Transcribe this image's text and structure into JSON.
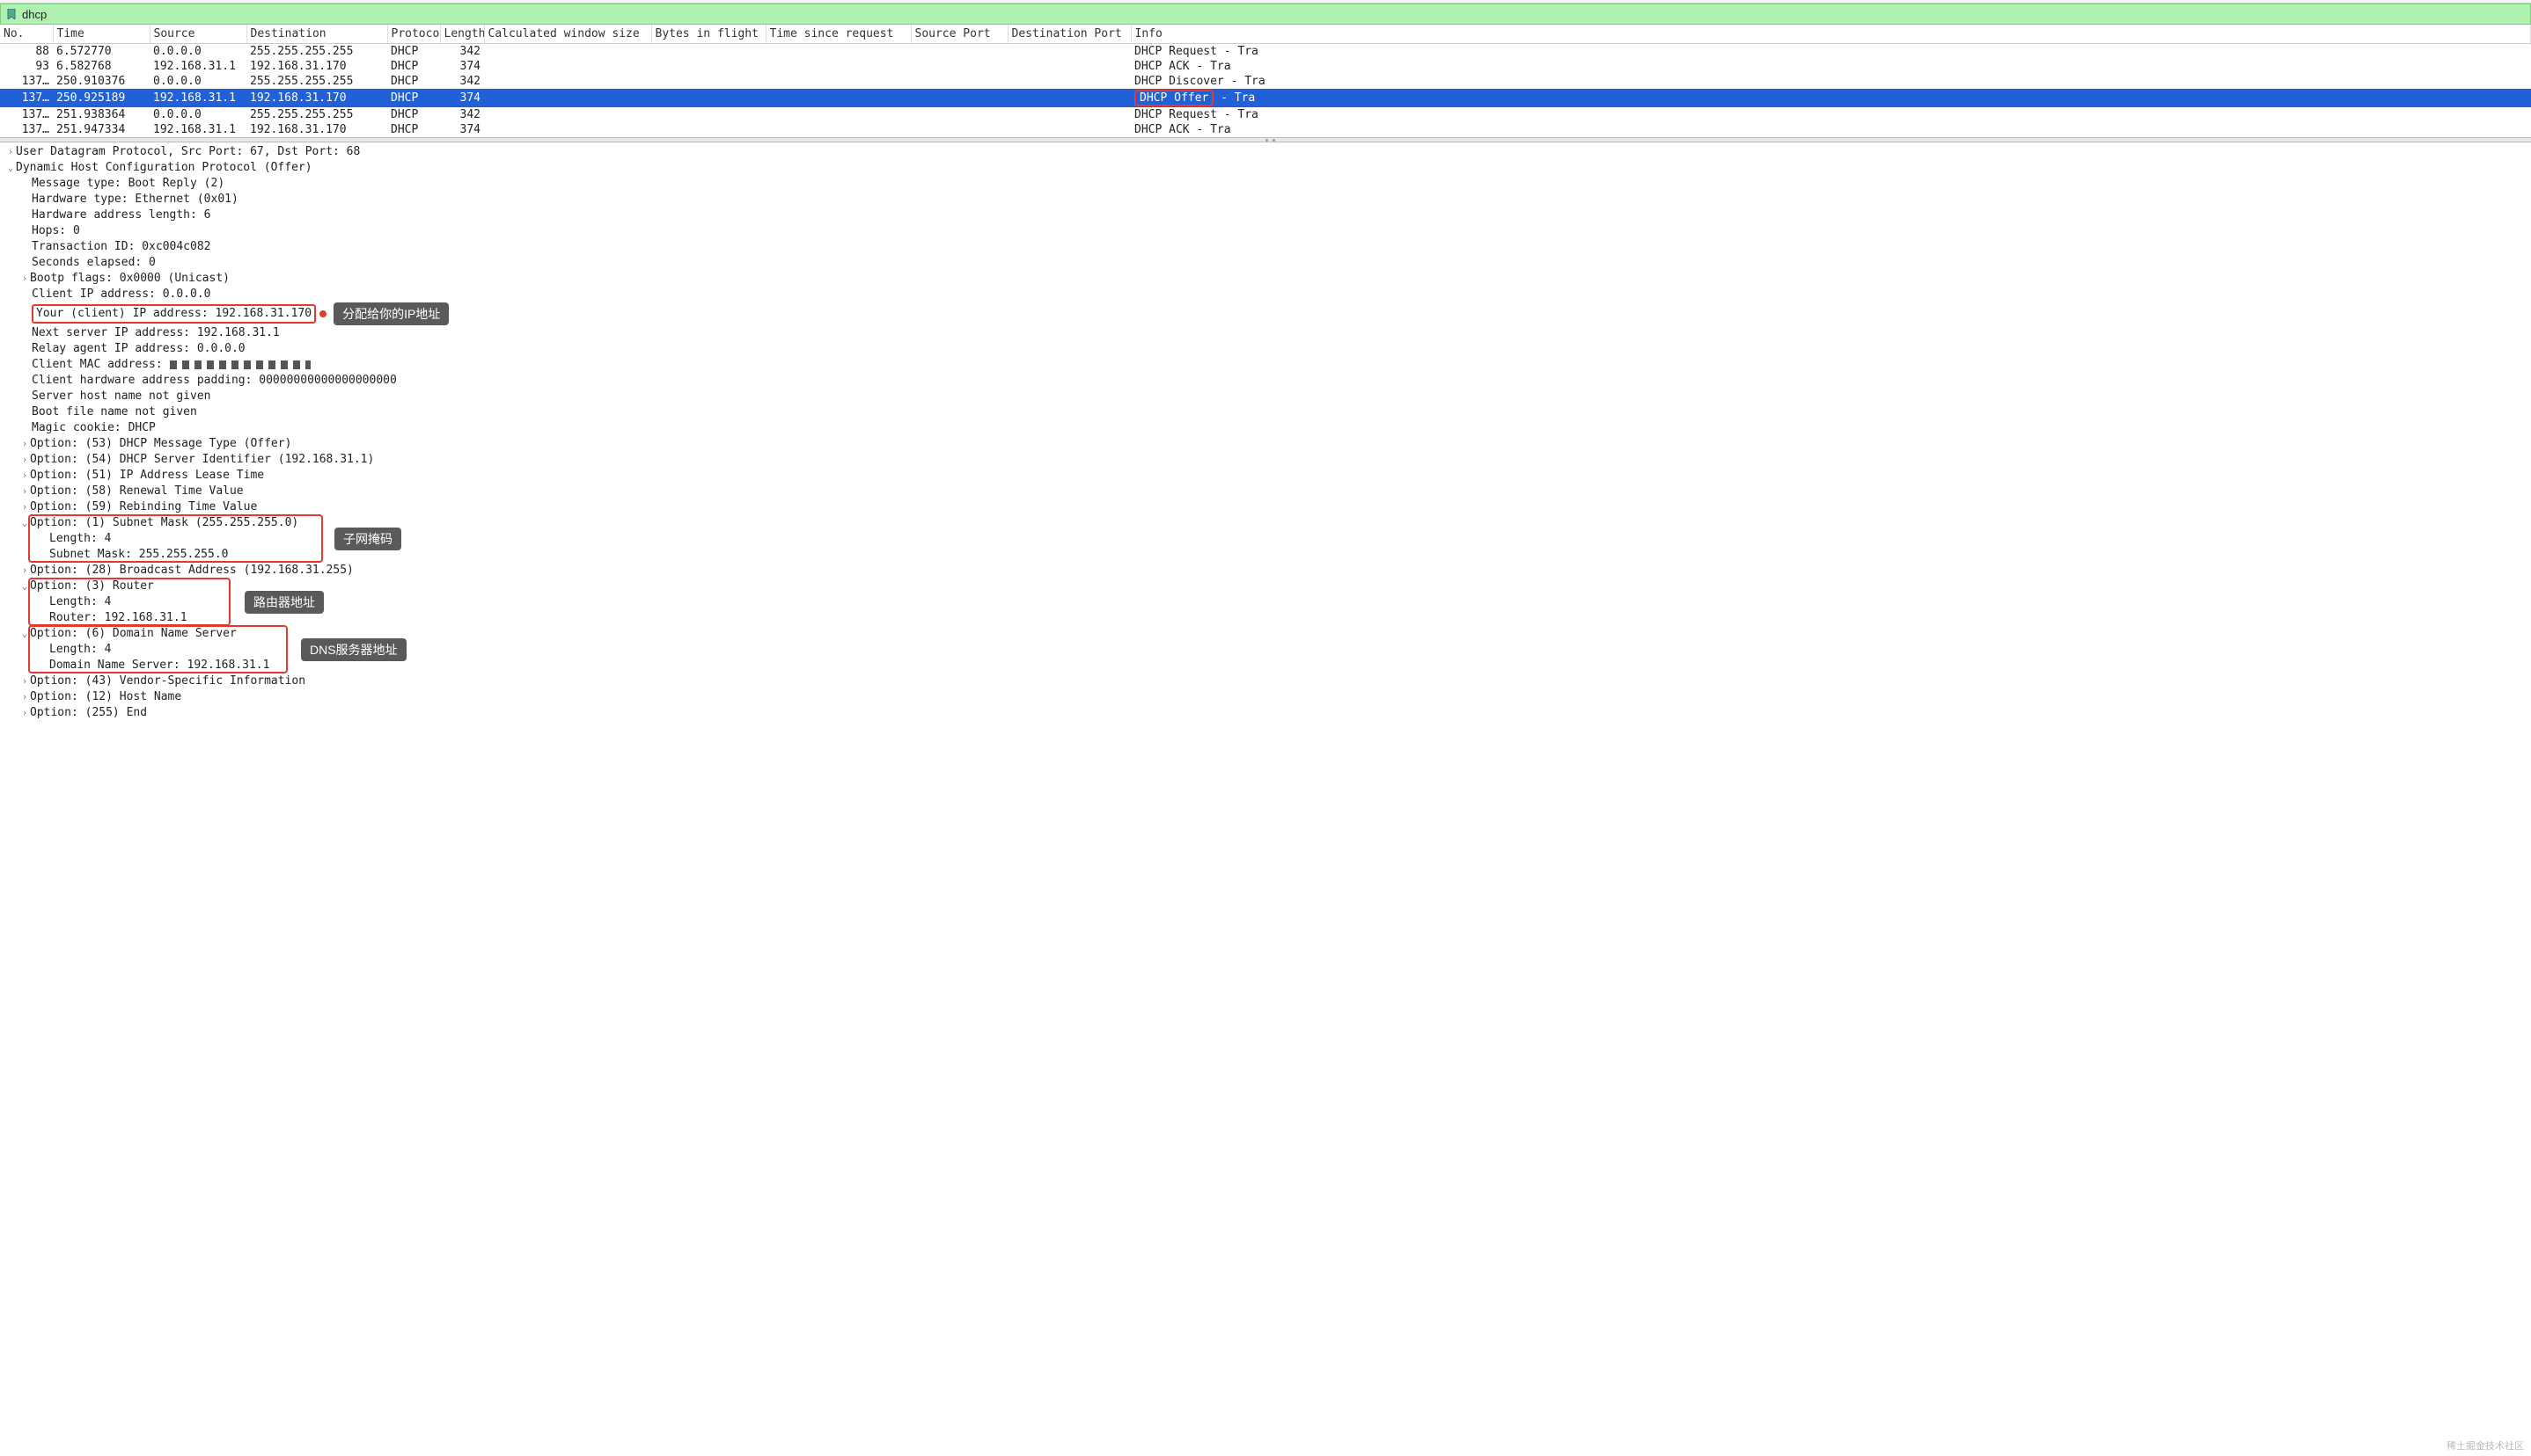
{
  "filter": {
    "value": "dhcp"
  },
  "columns": {
    "no": "No.",
    "time": "Time",
    "source": "Source",
    "destination": "Destination",
    "protocol": "Protocol",
    "length": "Length",
    "calc_win": "Calculated window size",
    "bytes_in_flight": "Bytes in flight",
    "time_since_req": "Time since request",
    "src_port": "Source Port",
    "dst_port": "Destination Port",
    "info": "Info"
  },
  "packets": [
    {
      "no": "88",
      "time": "6.572770",
      "src": "0.0.0.0",
      "dst": "255.255.255.255",
      "proto": "DHCP",
      "len": "342",
      "info": "DHCP Request  - Tra"
    },
    {
      "no": "93",
      "time": "6.582768",
      "src": "192.168.31.1",
      "dst": "192.168.31.170",
      "proto": "DHCP",
      "len": "374",
      "info": "DHCP ACK      - Tra"
    },
    {
      "no": "137…",
      "time": "250.910376",
      "src": "0.0.0.0",
      "dst": "255.255.255.255",
      "proto": "DHCP",
      "len": "342",
      "info": "DHCP Discover - Tra"
    },
    {
      "no": "137…",
      "time": "250.925189",
      "src": "192.168.31.1",
      "dst": "192.168.31.170",
      "proto": "DHCP",
      "len": "374",
      "info_hl": "DHCP Offer",
      "info_tail": "   - Tra",
      "selected": true
    },
    {
      "no": "137…",
      "time": "251.938364",
      "src": "0.0.0.0",
      "dst": "255.255.255.255",
      "proto": "DHCP",
      "len": "342",
      "info": "DHCP Request  - Tra"
    },
    {
      "no": "137…",
      "time": "251.947334",
      "src": "192.168.31.1",
      "dst": "192.168.31.170",
      "proto": "DHCP",
      "len": "374",
      "info": "DHCP ACK      - Tra"
    }
  ],
  "details": {
    "udp": "User Datagram Protocol, Src Port: 67, Dst Port: 68",
    "dhcp_header": "Dynamic Host Configuration Protocol (Offer)",
    "lines": {
      "msg_type": "Message type: Boot Reply (2)",
      "hw_type": "Hardware type: Ethernet (0x01)",
      "hw_len": "Hardware address length: 6",
      "hops": "Hops: 0",
      "txid": "Transaction ID: 0xc004c082",
      "secs": "Seconds elapsed: 0",
      "flags": "Bootp flags: 0x0000 (Unicast)",
      "ciaddr": "Client IP address: 0.0.0.0",
      "yiaddr": "Your (client) IP address: 192.168.31.170",
      "siaddr": "Next server IP address: 192.168.31.1",
      "giaddr": "Relay agent IP address: 0.0.0.0",
      "chaddr": "Client MAC address: ",
      "chpad": "Client hardware address padding: 00000000000000000000",
      "sname": "Server host name not given",
      "file": "Boot file name not given",
      "magic": "Magic cookie: DHCP",
      "opt53": "Option: (53) DHCP Message Type (Offer)",
      "opt54": "Option: (54) DHCP Server Identifier (192.168.31.1)",
      "opt51": "Option: (51) IP Address Lease Time",
      "opt58": "Option: (58) Renewal Time Value",
      "opt59": "Option: (59) Rebinding Time Value",
      "opt1": "Option: (1) Subnet Mask (255.255.255.0)",
      "opt1_len": "Length: 4",
      "opt1_val": "Subnet Mask: 255.255.255.0",
      "opt28": "Option: (28) Broadcast Address (192.168.31.255)",
      "opt3": "Option: (3) Router",
      "opt3_len": "Length: 4",
      "opt3_val": "Router: 192.168.31.1",
      "opt6": "Option: (6) Domain Name Server",
      "opt6_len": "Length: 4",
      "opt6_val": "Domain Name Server: 192.168.31.1",
      "opt43": "Option: (43) Vendor-Specific Information",
      "opt12": "Option: (12) Host Name",
      "opt255": "Option: (255) End"
    }
  },
  "callouts": {
    "yiaddr": "分配给你的IP地址",
    "subnet": "子网掩码",
    "router": "路由器地址",
    "dns": "DNS服务器地址"
  },
  "watermark": "稀土掘金技术社区"
}
